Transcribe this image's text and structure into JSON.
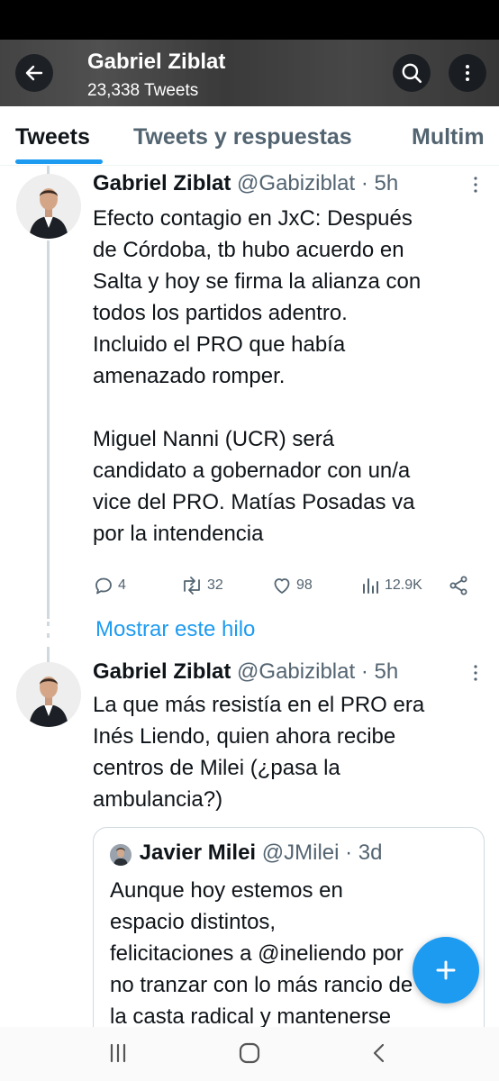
{
  "header": {
    "name": "Gabriel Ziblat",
    "tweet_count": "23,338 Tweets",
    "icons": {
      "back": "arrow-left-icon",
      "search": "search-icon",
      "more": "more-vertical-icon"
    }
  },
  "tabs": [
    {
      "label": "Tweets",
      "active": true
    },
    {
      "label": "Tweets y respuestas",
      "active": false
    },
    {
      "label": "Multim",
      "active": false
    }
  ],
  "tweets": [
    {
      "name": "Gabriel Ziblat",
      "handle": "@Gabiziblat",
      "time": "· 5h",
      "text": "Efecto contagio en JxC: Después\nde Córdoba, tb hubo acuerdo en\nSalta y hoy se firma la alianza con\ntodos los partidos adentro.\nIncluido el PRO que había\namenazado romper.\n\nMiguel Nanni (UCR) será\ncandidato a gobernador con un/a\nvice del PRO. Matías Posadas va\npor la intendencia",
      "replies": "4",
      "retweets": "32",
      "likes": "98",
      "views": "12.9K"
    },
    {
      "name": "Gabriel Ziblat",
      "handle": "@Gabiziblat",
      "time": "· 5h",
      "text": "La que más resistía en el PRO era\nInés Liendo, quien ahora recibe\ncentros de Milei (¿pasa la\nambulancia?)"
    }
  ],
  "show_thread": "Mostrar este hilo",
  "quote": {
    "name": "Javier Milei",
    "handle": "@JMilei",
    "time": "· 3d",
    "text": "Aunque hoy estemos en\nespacio distintos,\nfelicitaciones a @ineliendo por\nno tranzar con lo más rancio de\nla casta radical y mantenerse"
  },
  "colors": {
    "accent": "#1d9bf0",
    "text": "#0f1419",
    "secondary": "#536471",
    "border": "#cfd9de"
  }
}
